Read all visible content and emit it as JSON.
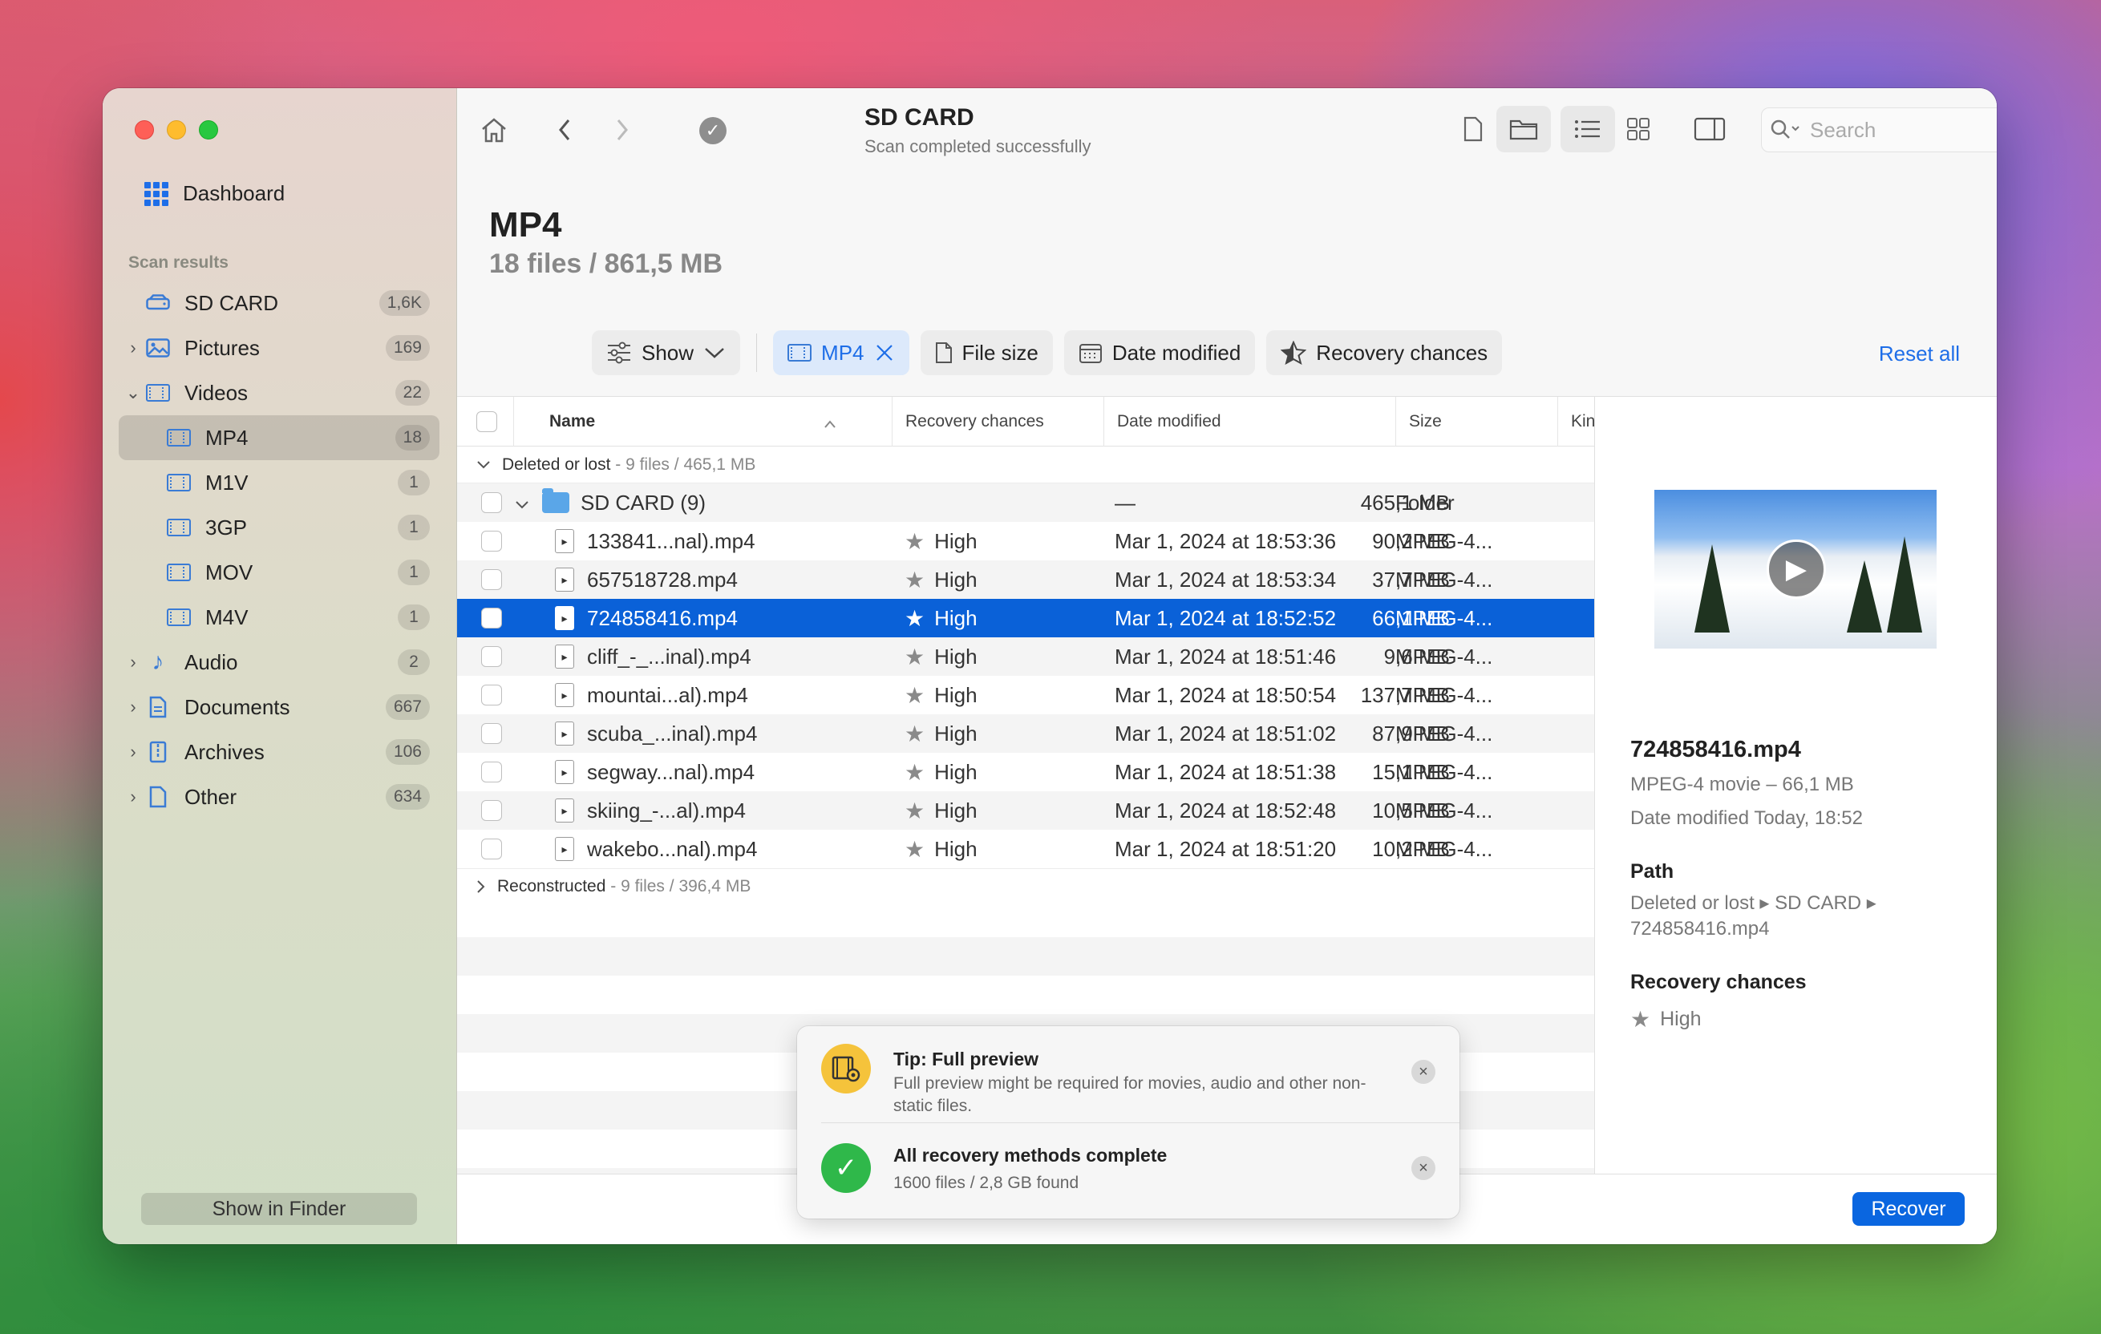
{
  "sidebar": {
    "dashboard_label": "Dashboard",
    "section_title": "Scan results",
    "items": [
      {
        "label": "SD CARD",
        "count": "1,6K"
      },
      {
        "label": "Pictures",
        "count": "169"
      },
      {
        "label": "Videos",
        "count": "22"
      },
      {
        "label": "MP4",
        "count": "18"
      },
      {
        "label": "M1V",
        "count": "1"
      },
      {
        "label": "3GP",
        "count": "1"
      },
      {
        "label": "MOV",
        "count": "1"
      },
      {
        "label": "M4V",
        "count": "1"
      },
      {
        "label": "Audio",
        "count": "2"
      },
      {
        "label": "Documents",
        "count": "667"
      },
      {
        "label": "Archives",
        "count": "106"
      },
      {
        "label": "Other",
        "count": "634"
      }
    ],
    "show_in_finder": "Show in Finder"
  },
  "toolbar": {
    "title": "SD CARD",
    "subtitle": "Scan completed successfully",
    "search_placeholder": "Search"
  },
  "main": {
    "heading": "MP4",
    "subheading": "18 files / 861,5 MB",
    "filters": {
      "show": "Show",
      "active_filter": "MP4",
      "file_size": "File size",
      "date_modified": "Date modified",
      "recovery_chances": "Recovery chances",
      "reset_all": "Reset all"
    }
  },
  "table": {
    "headers": {
      "name": "Name",
      "recovery": "Recovery chances",
      "date": "Date modified",
      "size": "Size",
      "kind": "Kind"
    },
    "group1": {
      "label": "Deleted or lost",
      "info": "- 9 files / 465,1 MB"
    },
    "folder": {
      "name": "SD CARD (9)",
      "date": "—",
      "size": "465,1 MB",
      "kind": "Folder"
    },
    "rows": [
      {
        "name": "133841...nal).mp4",
        "recovery": "High",
        "date": "Mar 1, 2024 at 18:53:36",
        "size": "90,2 MB",
        "kind": "MPEG-4..."
      },
      {
        "name": "657518728.mp4",
        "recovery": "High",
        "date": "Mar 1, 2024 at 18:53:34",
        "size": "37,7 MB",
        "kind": "MPEG-4..."
      },
      {
        "name": "724858416.mp4",
        "recovery": "High",
        "date": "Mar 1, 2024 at 18:52:52",
        "size": "66,1 MB",
        "kind": "MPEG-4..."
      },
      {
        "name": "cliff_-_...inal).mp4",
        "recovery": "High",
        "date": "Mar 1, 2024 at 18:51:46",
        "size": "9,6 MB",
        "kind": "MPEG-4..."
      },
      {
        "name": "mountai...al).mp4",
        "recovery": "High",
        "date": "Mar 1, 2024 at 18:50:54",
        "size": "137,7 MB",
        "kind": "MPEG-4..."
      },
      {
        "name": "scuba_...inal).mp4",
        "recovery": "High",
        "date": "Mar 1, 2024 at 18:51:02",
        "size": "87,9 MB",
        "kind": "MPEG-4..."
      },
      {
        "name": "segway...nal).mp4",
        "recovery": "High",
        "date": "Mar 1, 2024 at 18:51:38",
        "size": "15,1 MB",
        "kind": "MPEG-4..."
      },
      {
        "name": "skiing_-...al).mp4",
        "recovery": "High",
        "date": "Mar 1, 2024 at 18:52:48",
        "size": "10,5 MB",
        "kind": "MPEG-4..."
      },
      {
        "name": "wakebo...nal).mp4",
        "recovery": "High",
        "date": "Mar 1, 2024 at 18:51:20",
        "size": "10,2 MB",
        "kind": "MPEG-4..."
      }
    ],
    "group2": {
      "label": "Reconstructed",
      "info": "- 9 files / 396,4 MB"
    }
  },
  "toast": {
    "tip_title": "Tip: Full preview",
    "tip_text": "Full preview might be required for movies, audio and other non-static files.",
    "done_title": "All recovery methods complete",
    "done_text": "1600 files / 2,8 GB found"
  },
  "preview": {
    "name": "724858416.mp4",
    "type_line": "MPEG-4 movie – 66,1 MB",
    "date_line": "Date modified  Today, 18:52",
    "path_label": "Path",
    "path_value": "Deleted or lost ▸ SD CARD ▸ 724858416.mp4",
    "recovery_label": "Recovery chances",
    "recovery_value": "High"
  },
  "footer": {
    "recover": "Recover"
  }
}
